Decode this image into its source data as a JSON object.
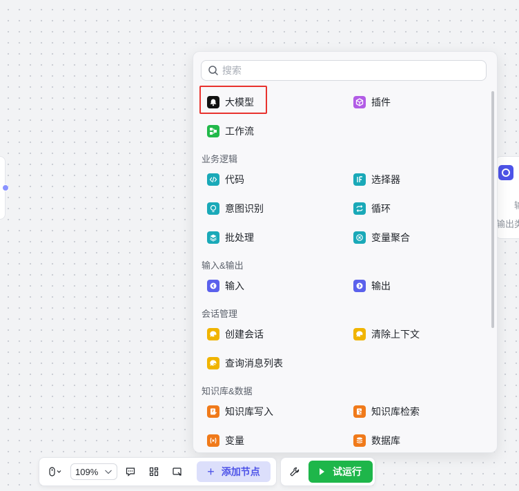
{
  "canvas": {
    "right_node": {
      "text_1": "输",
      "text_2": "输出类"
    }
  },
  "panel": {
    "search_placeholder": "搜索",
    "top_items": [
      {
        "label": "大模型",
        "icon": "llm-icon",
        "color": "#111111"
      },
      {
        "label": "插件",
        "icon": "plugin-cube-icon",
        "color": "#b25ce6"
      },
      {
        "label": "工作流",
        "icon": "workflow-icon",
        "color": "#22b94a"
      }
    ],
    "sections": [
      {
        "title": "业务逻辑",
        "items": [
          {
            "label": "代码",
            "icon": "code-icon",
            "color": "#1aa9b8"
          },
          {
            "label": "选择器",
            "icon": "if-selector-icon",
            "color": "#1aa9b8"
          },
          {
            "label": "意图识别",
            "icon": "intent-icon",
            "color": "#1aa9b8"
          },
          {
            "label": "循环",
            "icon": "loop-icon",
            "color": "#1aa9b8"
          },
          {
            "label": "批处理",
            "icon": "batch-icon",
            "color": "#1aa9b8"
          },
          {
            "label": "变量聚合",
            "icon": "variable-merge-icon",
            "color": "#1aa9b8"
          }
        ]
      },
      {
        "title": "输入&输出",
        "items": [
          {
            "label": "输入",
            "icon": "input-icon",
            "color": "#5b61ec"
          },
          {
            "label": "输出",
            "icon": "output-icon",
            "color": "#5b61ec"
          }
        ]
      },
      {
        "title": "会话管理",
        "items": [
          {
            "label": "创建会话",
            "icon": "create-conversation-icon",
            "color": "#f0b400"
          },
          {
            "label": "清除上下文",
            "icon": "clear-context-icon",
            "color": "#f0b400"
          },
          {
            "label": "查询消息列表",
            "icon": "message-list-icon",
            "color": "#f0b400"
          }
        ]
      },
      {
        "title": "知识库&数据",
        "items": [
          {
            "label": "知识库写入",
            "icon": "knowledge-write-icon",
            "color": "#f07a1a"
          },
          {
            "label": "知识库检索",
            "icon": "knowledge-search-icon",
            "color": "#f07a1a"
          },
          {
            "label": "变量",
            "icon": "variable-icon",
            "color": "#f07a1a"
          },
          {
            "label": "数据库",
            "icon": "database-icon",
            "color": "#f07a1a"
          }
        ]
      }
    ]
  },
  "toolbar": {
    "zoom_value": "109%",
    "add_node_label": "添加节点",
    "run_label": "试运行"
  }
}
